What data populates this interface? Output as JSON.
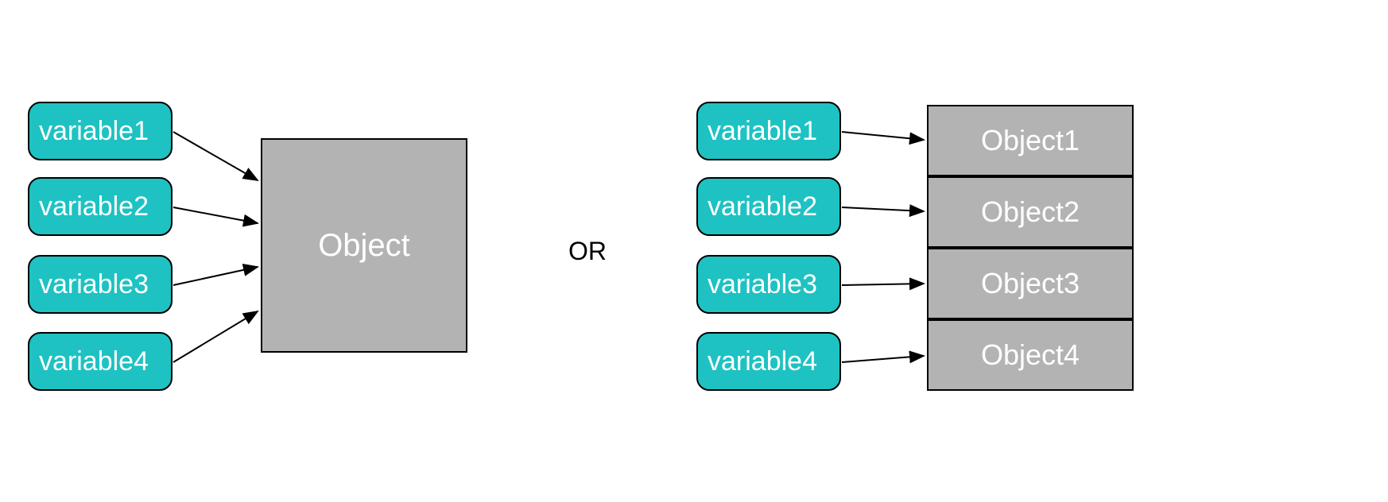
{
  "left": {
    "variables": [
      "variable1",
      "variable2",
      "variable3",
      "variable4"
    ],
    "object_label": "Object"
  },
  "or_label": "OR",
  "right": {
    "variables": [
      "variable1",
      "variable2",
      "variable3",
      "variable4"
    ],
    "objects": [
      "Object1",
      "Object2",
      "Object3",
      "Object4"
    ]
  },
  "colors": {
    "variable_fill": "#1ec2c2",
    "object_fill": "#b3b3b3",
    "text_on_fill": "#ffffff",
    "stroke": "#000000"
  }
}
